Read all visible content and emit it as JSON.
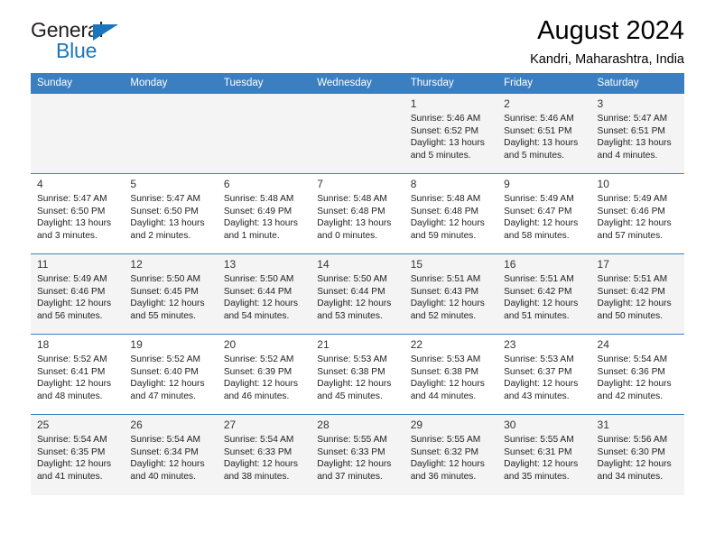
{
  "logo": {
    "word_one": "General",
    "word_two": "Blue",
    "triangle_color": "#1b75bb",
    "text_color": "#231f20"
  },
  "header": {
    "title": "August 2024",
    "subtitle": "Kandri, Maharashtra, India"
  },
  "theme": {
    "header_row_bg": "#3c7fc1",
    "header_row_text": "#ffffff",
    "alt_row_bg": "#f4f4f4",
    "row_divider": "#3c7fc1"
  },
  "weekday_headers": [
    "Sunday",
    "Monday",
    "Tuesday",
    "Wednesday",
    "Thursday",
    "Friday",
    "Saturday"
  ],
  "weeks": [
    [
      {
        "day": "",
        "sunrise": "",
        "sunset": "",
        "daylight_line1": "",
        "daylight_line2": ""
      },
      {
        "day": "",
        "sunrise": "",
        "sunset": "",
        "daylight_line1": "",
        "daylight_line2": ""
      },
      {
        "day": "",
        "sunrise": "",
        "sunset": "",
        "daylight_line1": "",
        "daylight_line2": ""
      },
      {
        "day": "",
        "sunrise": "",
        "sunset": "",
        "daylight_line1": "",
        "daylight_line2": ""
      },
      {
        "day": "1",
        "sunrise": "Sunrise: 5:46 AM",
        "sunset": "Sunset: 6:52 PM",
        "daylight_line1": "Daylight: 13 hours",
        "daylight_line2": "and 5 minutes."
      },
      {
        "day": "2",
        "sunrise": "Sunrise: 5:46 AM",
        "sunset": "Sunset: 6:51 PM",
        "daylight_line1": "Daylight: 13 hours",
        "daylight_line2": "and 5 minutes."
      },
      {
        "day": "3",
        "sunrise": "Sunrise: 5:47 AM",
        "sunset": "Sunset: 6:51 PM",
        "daylight_line1": "Daylight: 13 hours",
        "daylight_line2": "and 4 minutes."
      }
    ],
    [
      {
        "day": "4",
        "sunrise": "Sunrise: 5:47 AM",
        "sunset": "Sunset: 6:50 PM",
        "daylight_line1": "Daylight: 13 hours",
        "daylight_line2": "and 3 minutes."
      },
      {
        "day": "5",
        "sunrise": "Sunrise: 5:47 AM",
        "sunset": "Sunset: 6:50 PM",
        "daylight_line1": "Daylight: 13 hours",
        "daylight_line2": "and 2 minutes."
      },
      {
        "day": "6",
        "sunrise": "Sunrise: 5:48 AM",
        "sunset": "Sunset: 6:49 PM",
        "daylight_line1": "Daylight: 13 hours",
        "daylight_line2": "and 1 minute."
      },
      {
        "day": "7",
        "sunrise": "Sunrise: 5:48 AM",
        "sunset": "Sunset: 6:48 PM",
        "daylight_line1": "Daylight: 13 hours",
        "daylight_line2": "and 0 minutes."
      },
      {
        "day": "8",
        "sunrise": "Sunrise: 5:48 AM",
        "sunset": "Sunset: 6:48 PM",
        "daylight_line1": "Daylight: 12 hours",
        "daylight_line2": "and 59 minutes."
      },
      {
        "day": "9",
        "sunrise": "Sunrise: 5:49 AM",
        "sunset": "Sunset: 6:47 PM",
        "daylight_line1": "Daylight: 12 hours",
        "daylight_line2": "and 58 minutes."
      },
      {
        "day": "10",
        "sunrise": "Sunrise: 5:49 AM",
        "sunset": "Sunset: 6:46 PM",
        "daylight_line1": "Daylight: 12 hours",
        "daylight_line2": "and 57 minutes."
      }
    ],
    [
      {
        "day": "11",
        "sunrise": "Sunrise: 5:49 AM",
        "sunset": "Sunset: 6:46 PM",
        "daylight_line1": "Daylight: 12 hours",
        "daylight_line2": "and 56 minutes."
      },
      {
        "day": "12",
        "sunrise": "Sunrise: 5:50 AM",
        "sunset": "Sunset: 6:45 PM",
        "daylight_line1": "Daylight: 12 hours",
        "daylight_line2": "and 55 minutes."
      },
      {
        "day": "13",
        "sunrise": "Sunrise: 5:50 AM",
        "sunset": "Sunset: 6:44 PM",
        "daylight_line1": "Daylight: 12 hours",
        "daylight_line2": "and 54 minutes."
      },
      {
        "day": "14",
        "sunrise": "Sunrise: 5:50 AM",
        "sunset": "Sunset: 6:44 PM",
        "daylight_line1": "Daylight: 12 hours",
        "daylight_line2": "and 53 minutes."
      },
      {
        "day": "15",
        "sunrise": "Sunrise: 5:51 AM",
        "sunset": "Sunset: 6:43 PM",
        "daylight_line1": "Daylight: 12 hours",
        "daylight_line2": "and 52 minutes."
      },
      {
        "day": "16",
        "sunrise": "Sunrise: 5:51 AM",
        "sunset": "Sunset: 6:42 PM",
        "daylight_line1": "Daylight: 12 hours",
        "daylight_line2": "and 51 minutes."
      },
      {
        "day": "17",
        "sunrise": "Sunrise: 5:51 AM",
        "sunset": "Sunset: 6:42 PM",
        "daylight_line1": "Daylight: 12 hours",
        "daylight_line2": "and 50 minutes."
      }
    ],
    [
      {
        "day": "18",
        "sunrise": "Sunrise: 5:52 AM",
        "sunset": "Sunset: 6:41 PM",
        "daylight_line1": "Daylight: 12 hours",
        "daylight_line2": "and 48 minutes."
      },
      {
        "day": "19",
        "sunrise": "Sunrise: 5:52 AM",
        "sunset": "Sunset: 6:40 PM",
        "daylight_line1": "Daylight: 12 hours",
        "daylight_line2": "and 47 minutes."
      },
      {
        "day": "20",
        "sunrise": "Sunrise: 5:52 AM",
        "sunset": "Sunset: 6:39 PM",
        "daylight_line1": "Daylight: 12 hours",
        "daylight_line2": "and 46 minutes."
      },
      {
        "day": "21",
        "sunrise": "Sunrise: 5:53 AM",
        "sunset": "Sunset: 6:38 PM",
        "daylight_line1": "Daylight: 12 hours",
        "daylight_line2": "and 45 minutes."
      },
      {
        "day": "22",
        "sunrise": "Sunrise: 5:53 AM",
        "sunset": "Sunset: 6:38 PM",
        "daylight_line1": "Daylight: 12 hours",
        "daylight_line2": "and 44 minutes."
      },
      {
        "day": "23",
        "sunrise": "Sunrise: 5:53 AM",
        "sunset": "Sunset: 6:37 PM",
        "daylight_line1": "Daylight: 12 hours",
        "daylight_line2": "and 43 minutes."
      },
      {
        "day": "24",
        "sunrise": "Sunrise: 5:54 AM",
        "sunset": "Sunset: 6:36 PM",
        "daylight_line1": "Daylight: 12 hours",
        "daylight_line2": "and 42 minutes."
      }
    ],
    [
      {
        "day": "25",
        "sunrise": "Sunrise: 5:54 AM",
        "sunset": "Sunset: 6:35 PM",
        "daylight_line1": "Daylight: 12 hours",
        "daylight_line2": "and 41 minutes."
      },
      {
        "day": "26",
        "sunrise": "Sunrise: 5:54 AM",
        "sunset": "Sunset: 6:34 PM",
        "daylight_line1": "Daylight: 12 hours",
        "daylight_line2": "and 40 minutes."
      },
      {
        "day": "27",
        "sunrise": "Sunrise: 5:54 AM",
        "sunset": "Sunset: 6:33 PM",
        "daylight_line1": "Daylight: 12 hours",
        "daylight_line2": "and 38 minutes."
      },
      {
        "day": "28",
        "sunrise": "Sunrise: 5:55 AM",
        "sunset": "Sunset: 6:33 PM",
        "daylight_line1": "Daylight: 12 hours",
        "daylight_line2": "and 37 minutes."
      },
      {
        "day": "29",
        "sunrise": "Sunrise: 5:55 AM",
        "sunset": "Sunset: 6:32 PM",
        "daylight_line1": "Daylight: 12 hours",
        "daylight_line2": "and 36 minutes."
      },
      {
        "day": "30",
        "sunrise": "Sunrise: 5:55 AM",
        "sunset": "Sunset: 6:31 PM",
        "daylight_line1": "Daylight: 12 hours",
        "daylight_line2": "and 35 minutes."
      },
      {
        "day": "31",
        "sunrise": "Sunrise: 5:56 AM",
        "sunset": "Sunset: 6:30 PM",
        "daylight_line1": "Daylight: 12 hours",
        "daylight_line2": "and 34 minutes."
      }
    ]
  ]
}
